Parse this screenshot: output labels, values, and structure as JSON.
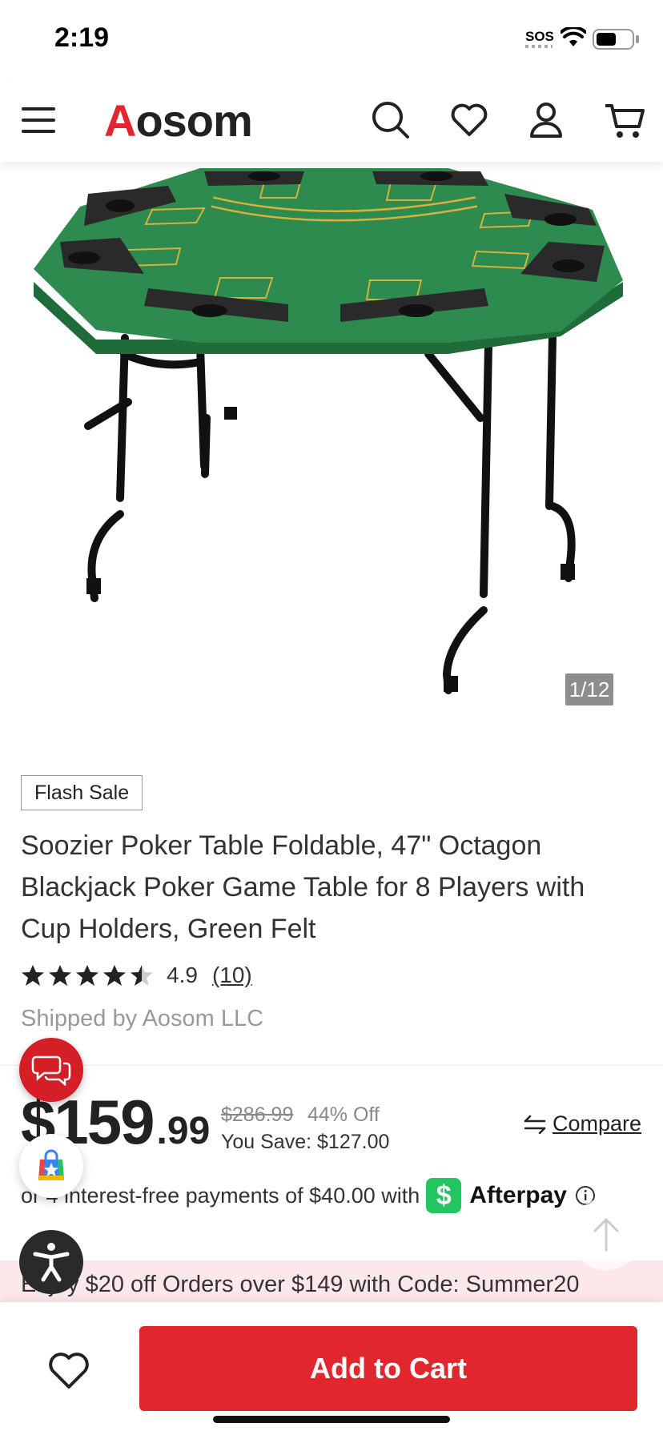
{
  "status_bar": {
    "time": "2:19",
    "sos": "SOS"
  },
  "header": {
    "logo_first": "A",
    "logo_rest": "osom",
    "icons": [
      "menu-icon",
      "search-icon",
      "heart-icon",
      "account-icon",
      "cart-icon"
    ]
  },
  "gallery": {
    "counter": "1/12"
  },
  "product": {
    "badge": "Flash Sale",
    "title": "Soozier Poker Table Foldable, 47\" Octagon Blackjack Poker Game Table for 8 Players with Cup Holders, Green Felt",
    "rating": "4.9",
    "rating_stars": 4.9,
    "review_count": "(10)",
    "shipped_by": "Shipped by Aosom LLC"
  },
  "pricing": {
    "dollars": "$159",
    "cents": ".99",
    "original": "$286.99",
    "discount": "44% Off",
    "savings": "You Save: $127.00",
    "compare_label": "Compare"
  },
  "afterpay": {
    "text": "or 4 interest-free payments of $40.00 with",
    "badge": "$",
    "brand": "Afterpay"
  },
  "promo": {
    "text": "Enjoy $20 off Orders over $149 with Code: Summer20"
  },
  "bottom_bar": {
    "add_to_cart": "Add to Cart"
  },
  "colors": {
    "brand_red": "#e1262d",
    "felt_green": "#2e8b4f",
    "afterpay_green": "#22c55e",
    "promo_bg": "#fce8ea"
  }
}
